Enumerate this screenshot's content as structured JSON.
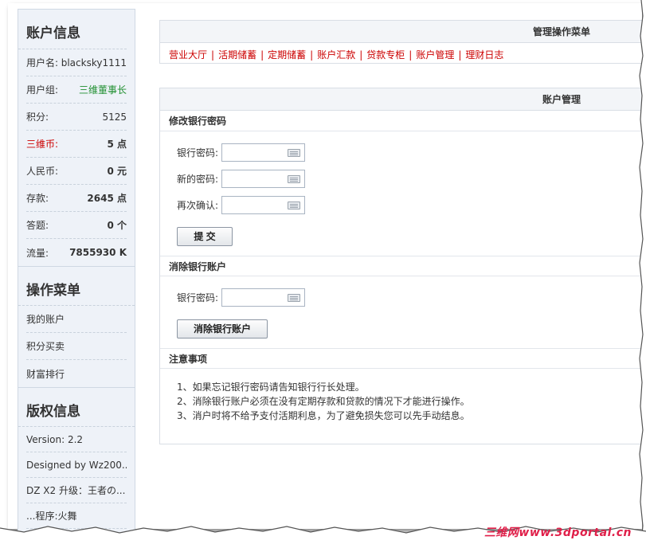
{
  "sidebar": {
    "account_title": "账户信息",
    "rows": [
      {
        "label": "用户名:",
        "value": "blacksky1111"
      },
      {
        "label": "用户组:",
        "value": "三维董事长"
      },
      {
        "label": "积分:",
        "value": "5125"
      },
      {
        "label": "三维币:",
        "value": "5 点"
      },
      {
        "label": "人民币:",
        "value": "0 元"
      },
      {
        "label": "存款:",
        "value": "2645 点"
      },
      {
        "label": "答题:",
        "value": "0 个"
      },
      {
        "label": "流量:",
        "value": "7855930 K"
      }
    ],
    "menu_title": "操作菜单",
    "menu_items": [
      "我的账户",
      "积分买卖",
      "财富排行"
    ],
    "copyright_title": "版权信息",
    "copyright_items": [
      "Version: 2.2",
      "Designed by Wz200...",
      "DZ X2 升级：王者の...",
      "...程序:火舞"
    ]
  },
  "top_menu": {
    "title": "管理操作菜单",
    "links": [
      "营业大厅",
      "活期储蓄",
      "定期储蓄",
      "账户汇款",
      "贷款专柜",
      "账户管理",
      "理财日志"
    ],
    "separator": "|"
  },
  "account": {
    "title": "账户管理",
    "change_pwd": {
      "heading": "修改银行密码",
      "fields": [
        "银行密码:",
        "新的密码:",
        "再次确认:"
      ],
      "submit_label": "提 交"
    },
    "close_account": {
      "heading": "消除银行账户",
      "field": "银行密码:",
      "button_label": "消除银行账户"
    },
    "notes": {
      "heading": "注意事项",
      "items": [
        "1、如果忘记银行密码请告知银行行长处理。",
        "2、消除银行账户必须在没有定期存款和贷款的情况下才能进行操作。",
        "3、消户时将不给予支付活期利息，为了避免损失您可以先手动结息。"
      ]
    }
  },
  "watermark": "三维网www.3dportal.cn",
  "colors": {
    "accent_red": "#cc0000",
    "group_green": "#1f8f2f",
    "sidebar_bg": "#eef2f8"
  }
}
